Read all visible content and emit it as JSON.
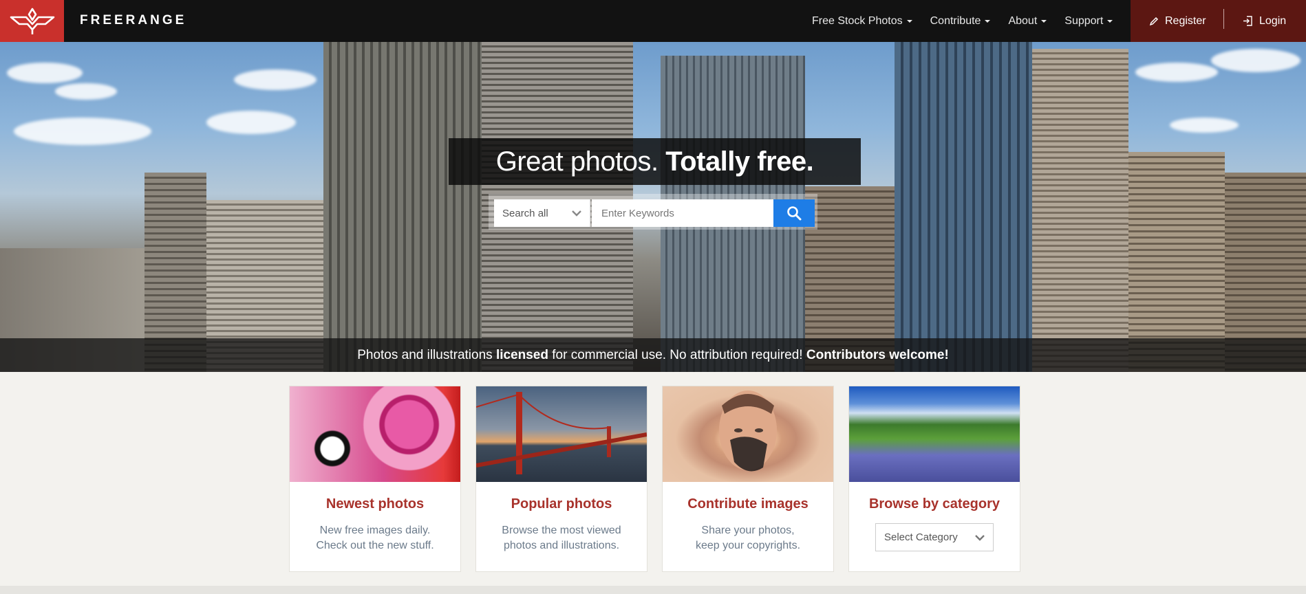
{
  "brand": {
    "name": "FREERANGE"
  },
  "nav": {
    "items": [
      {
        "label": "Free Stock Photos"
      },
      {
        "label": "Contribute"
      },
      {
        "label": "About"
      },
      {
        "label": "Support"
      }
    ]
  },
  "account": {
    "register_label": "Register",
    "login_label": "Login"
  },
  "hero": {
    "title_regular": "Great photos.",
    "title_bold": "Totally free.",
    "search": {
      "scope_label": "Search all",
      "placeholder": "Enter Keywords"
    },
    "tagline": {
      "part1": "Photos and illustrations",
      "part2": "licensed",
      "part3": "for commercial use. No attribution required!",
      "part4": "Contributors welcome!"
    }
  },
  "cards": [
    {
      "title": "Newest photos",
      "desc_line1": "New free images daily.",
      "desc_line2": "Check out the new stuff."
    },
    {
      "title": "Popular photos",
      "desc_line1": "Browse the most viewed",
      "desc_line2": "photos and illustrations."
    },
    {
      "title": "Contribute images",
      "desc_line1": "Share your photos,",
      "desc_line2": "keep your copyrights."
    },
    {
      "title": "Browse by category",
      "select_label": "Select Category"
    }
  ],
  "colors": {
    "brand_red": "#c9302c",
    "dark_red": "#5c1712",
    "search_blue": "#1e7de6",
    "title_red": "#a8322b"
  },
  "icons": [
    "freerange-bird-logo",
    "pencil-icon",
    "login-icon",
    "search-icon",
    "chevron-down-icon"
  ]
}
